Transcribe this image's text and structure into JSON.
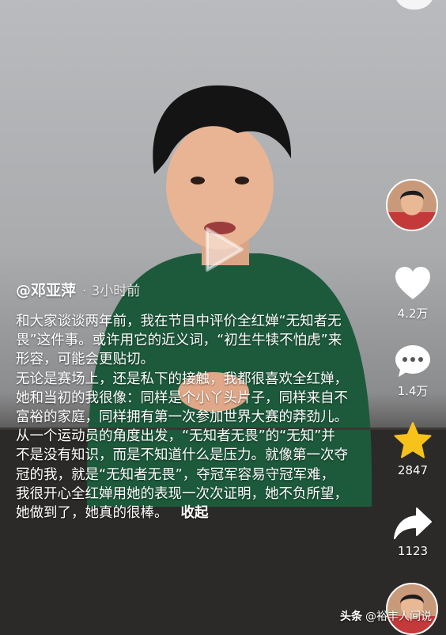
{
  "post": {
    "author": "@邓亚萍",
    "separator": "·",
    "time": "3小时前",
    "paragraphs": [
      "和大家谈谈两年前，我在节目中评价全红婵“无知者无畏”这件事。或许用它的近义词，“初生牛犊不怕虎”来形容，可能会更贴切。",
      "无论是赛场上，还是私下的接触，我都很喜欢全红婵，她和当初的我很像：同样是个小丫头片子，同样来自不富裕的家庭，同样拥有第一次参加世界大赛的莽劲儿。",
      "从一个运动员的角度出发，“无知者无畏”的“无知”并不是没有知识，而是不知道什么是压力。就像第一次夺冠的我，就是“无知者无畏”，夺冠军容易守冠军难，我很开心全红婵用她的表现一次次证明，她不负所望，她做到了，她真的很棒。"
    ],
    "collapse_label": "收起"
  },
  "actions": {
    "like_count": "4.2万",
    "comment_count": "1.4万",
    "favorite_count": "2847",
    "share_count": "1123"
  },
  "watermark": {
    "brand": "头条",
    "handle": "@裕丰人间说"
  },
  "colors": {
    "star": "#f7c31b",
    "text": "#ffffff"
  }
}
